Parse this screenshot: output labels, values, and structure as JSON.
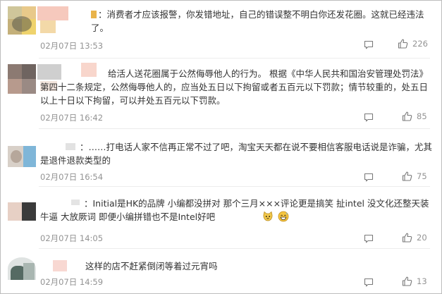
{
  "comments": [
    {
      "text": "：消费者才应该报警，你发错地址，自己的错误整不明白你还发花圈。这就已经违法了。",
      "time": "02月07日 13:53",
      "likes": "226"
    },
    {
      "text": "给活人送花圈属于公然侮辱他人的行为。 根据《中华人民共和国治安管理处罚法》第四十二条规定，公然侮辱他人的，应当处五日以下拘留或者五百元以下罚款；情节较重的，处五日以上十日以下拘留，可以并处五百元以下罚款。",
      "time": "02月07日 16:42",
      "likes": "85"
    },
    {
      "text": "：……打电话人家不信再正常不过了吧，淘宝天天都在说不要相信客服电话说是诈骗，尤其是退件退款类型的",
      "time": "02月07日 16:54",
      "likes": "75"
    },
    {
      "text": "：Initial是HK的品牌 小编都没拼对 那个三月×××评论更是搞笑 扯intel 没文化还整天装牛逼 大放厥词 即便小编拼错也不是Intel好吧",
      "time": "02月07日 14:05",
      "likes": "20"
    },
    {
      "text": "这样的店不赶紧倒闭等着过元宵吗",
      "time": "02月07日 14:59",
      "likes": "13"
    }
  ],
  "colors": {
    "text": "#333333",
    "meta": "#939393",
    "divider": "#ececec",
    "border": "#bdbdbd"
  },
  "icons": {
    "reply": "comment-icon",
    "like": "thumbs-up-icon",
    "emoji_4a": "cat-face-emoji-icon",
    "emoji_4b": "grinning-sweat-emoji-icon"
  }
}
